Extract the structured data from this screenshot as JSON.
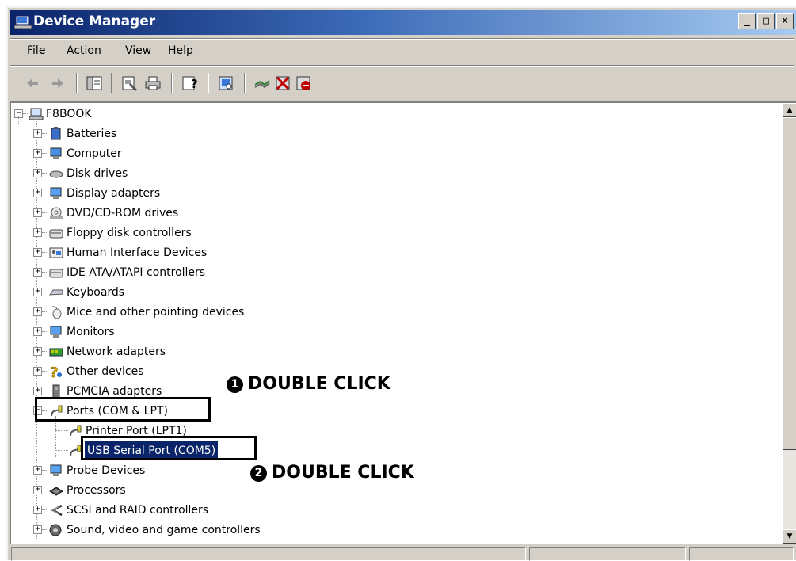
{
  "window": {
    "title": "Device Manager"
  },
  "controls": {
    "minimize": "_",
    "maximize": "□",
    "close": "×"
  },
  "menu": {
    "file": "File",
    "action": "Action",
    "view": "View",
    "help": "Help"
  },
  "toolbar": [
    "back-icon",
    "forward-icon",
    "show-hide-tree-icon",
    "properties-icon",
    "print-icon",
    "help-icon",
    "scan-hardware-icon",
    "update-driver-icon",
    "uninstall-icon",
    "disable-icon"
  ],
  "tree": {
    "root": "F8BOOK",
    "items": {
      "batteries": "Batteries",
      "computer": "Computer",
      "disk_drives": "Disk drives",
      "display_adapters": "Display adapters",
      "dvd": "DVD/CD-ROM drives",
      "floppy": "Floppy disk controllers",
      "hid": "Human Interface Devices",
      "ide": "IDE ATA/ATAPI controllers",
      "keyboards": "Keyboards",
      "mice": "Mice and other pointing devices",
      "monitors": "Monitors",
      "network": "Network adapters",
      "other": "Other devices",
      "pcmcia": "PCMCIA adapters",
      "ports": "Ports (COM & LPT)",
      "printer_port": "Printer Port (LPT1)",
      "usb_serial": "USB Serial Port (COM5)",
      "probe": "Probe Devices",
      "processors": "Processors",
      "scsi": "SCSI and RAID controllers",
      "sound": "Sound, video and game controllers"
    }
  },
  "annotations": {
    "one": {
      "number": "1",
      "text": "DOUBLE CLICK"
    },
    "two": {
      "number": "2",
      "text": "DOUBLE CLICK"
    }
  },
  "colors": {
    "titlebar": "#0a246a",
    "selection": "#0a246a",
    "face": "#d4d0c8"
  }
}
